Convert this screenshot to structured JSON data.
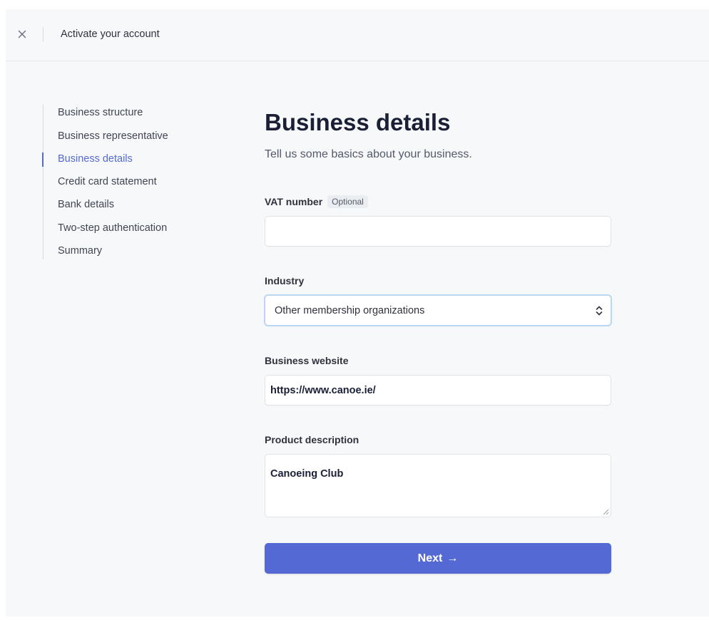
{
  "header": {
    "title": "Activate your account",
    "close_icon": "close-icon"
  },
  "sidebar": {
    "items": [
      {
        "label": "Business structure",
        "active": false
      },
      {
        "label": "Business representative",
        "active": false
      },
      {
        "label": "Business details",
        "active": true
      },
      {
        "label": "Credit card statement",
        "active": false
      },
      {
        "label": "Bank details",
        "active": false
      },
      {
        "label": "Two-step authentication",
        "active": false
      },
      {
        "label": "Summary",
        "active": false
      }
    ]
  },
  "main": {
    "title": "Business details",
    "subtitle": "Tell us some basics about your business."
  },
  "form": {
    "vat": {
      "label": "VAT number",
      "badge": "Optional",
      "value": ""
    },
    "industry": {
      "label": "Industry",
      "selected": "Other membership organizations"
    },
    "website": {
      "label": "Business website",
      "value": "https://www.canoe.ie/"
    },
    "product": {
      "label": "Product description",
      "value": "Canoeing Club"
    },
    "next": {
      "label": "Next",
      "icon": "→"
    }
  },
  "colors": {
    "accent": "#5469d4",
    "background": "#f6f8fa",
    "focus_ring": "#b9d6f2"
  }
}
